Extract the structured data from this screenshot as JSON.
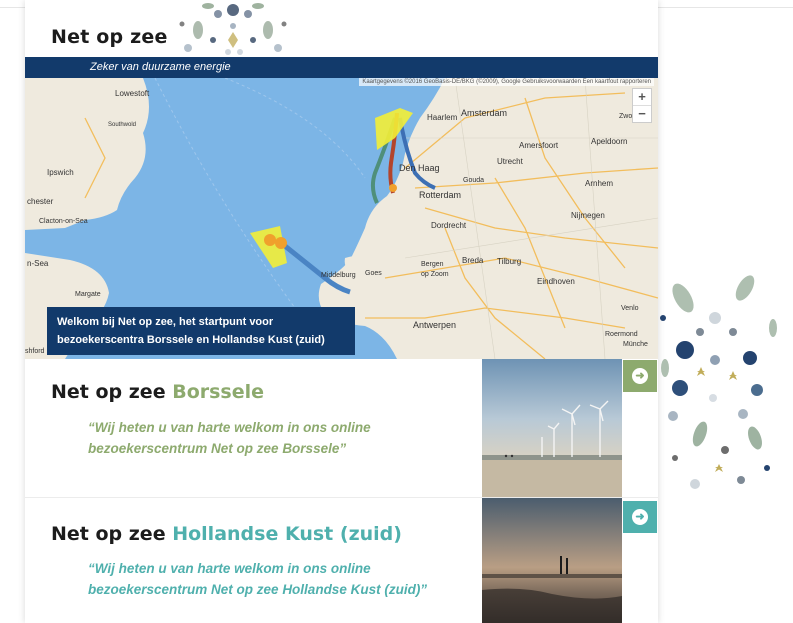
{
  "header": {
    "logo_text": "Net op zee",
    "tagline": "Zeker van duurzame energie"
  },
  "map": {
    "attribution": "Kaartgegevens ©2016 GeoBasis-DE/BKG (©2009), Google  Gebruiksvoorwaarden  Een kaartfout rapporteren",
    "zoom_in": "+",
    "zoom_out": "−",
    "welcome_line1": "Welkom bij Net op zee, het startpunt voor",
    "welcome_line2": "bezoekerscentra Borssele en Hollandse Kust (zuid)",
    "places": {
      "lowestoft": "Lowestoft",
      "southwold": "Southwold",
      "ipswich": "Ipswich",
      "chester": "chester",
      "clacton": "Clacton-on-Sea",
      "onsea": "n-Sea",
      "margate": "Margate",
      "ashford": "shford",
      "haarlem": "Haarlem",
      "amsterdam": "Amsterdam",
      "denhaag": "Den Haag",
      "rotterdam": "Rotterdam",
      "utrecht": "Utrecht",
      "amersfoort": "Amersfoort",
      "apeldoorn": "Apeldoorn",
      "zwolle": "Zwolle",
      "arnhem": "Arnhem",
      "nijmegen": "Nijmegen",
      "dordrecht": "Dordrecht",
      "breda": "Breda",
      "tilburg": "Tilburg",
      "eindhoven": "Eindhoven",
      "middelburg": "Middelburg",
      "goes": "Goes",
      "bergen": "Bergen",
      "opzoom": "op Zoom",
      "antwerpen": "Antwerpen",
      "venlo": "Venlo",
      "roermond": "Roermond",
      "monchen": "Münche",
      "gouda": "Gouda"
    }
  },
  "sections": [
    {
      "title_prefix": "Net op zee",
      "title_accent": "Borssele",
      "quote_line1": "“Wij heten u van harte welkom in ons online",
      "quote_line2": "bezoekerscentrum Net op zee Borssele”",
      "arrow": "➜"
    },
    {
      "title_prefix": "Net op zee",
      "title_accent": "Hollandse Kust (zuid)",
      "quote_line1": "“Wij heten u van harte welkom in ons online",
      "quote_line2": "bezoekerscentrum Net op zee Hollandse Kust (zuid)”",
      "arrow": "➜"
    }
  ],
  "colors": {
    "navy": "#123a6b",
    "green_accent": "#8daa6e",
    "teal_accent": "#4fb0ad",
    "sea": "#7cb5e6",
    "land": "#efeade"
  },
  "icons": [
    "zoom-in-icon",
    "zoom-out-icon",
    "arrow-right-icon",
    "decorative-pattern-icon"
  ]
}
